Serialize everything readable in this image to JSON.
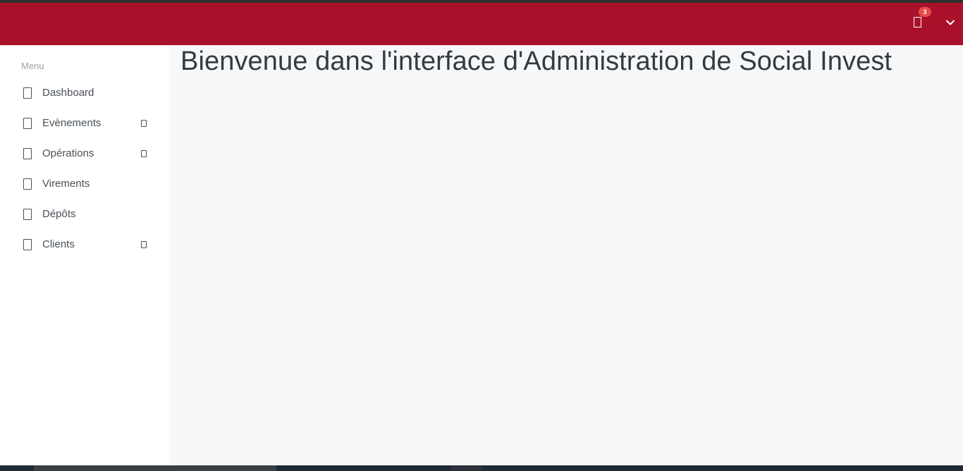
{
  "header": {
    "notification_icon": "bell-icon",
    "notification_count": "3",
    "user_menu_icon": "chevron-down-icon",
    "brand_color": "#a9112a",
    "badge_color": "#e84b4b"
  },
  "sidebar": {
    "menu_title": "Menu",
    "items": [
      {
        "label": "Dashboard",
        "icon": "dashboard-icon",
        "has_submenu": false
      },
      {
        "label": "Evènements",
        "icon": "calendar-icon",
        "has_submenu": true
      },
      {
        "label": "Opérations",
        "icon": "operations-icon",
        "has_submenu": true
      },
      {
        "label": "Virements",
        "icon": "transfer-icon",
        "has_submenu": false
      },
      {
        "label": "Dépôts",
        "icon": "deposit-icon",
        "has_submenu": false
      },
      {
        "label": "Clients",
        "icon": "users-icon",
        "has_submenu": true
      }
    ]
  },
  "main": {
    "title": "Bienvenue dans l'interface d'Administration de Social Invest",
    "background": "#f5f7f9"
  }
}
